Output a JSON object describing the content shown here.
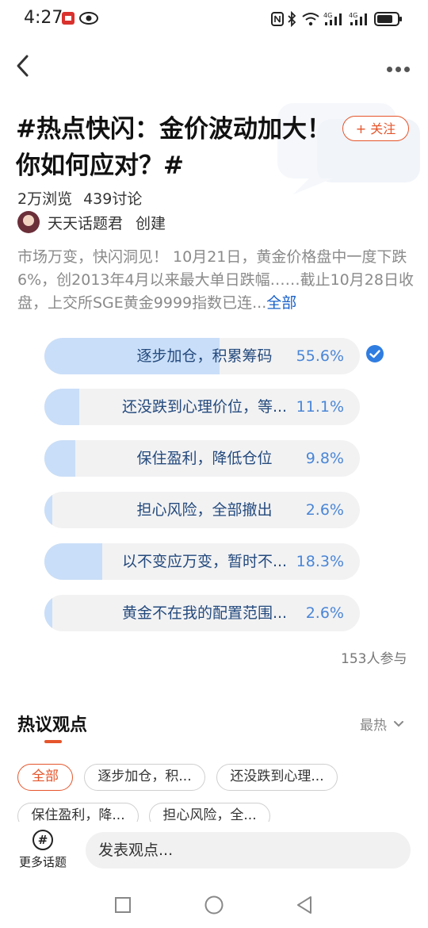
{
  "status_bar": {
    "time": "4:27"
  },
  "topic": {
    "title": "#热点快闪：金价波动加大！你如何应对？#",
    "follow_label": "+ 关注",
    "views": "2万浏览",
    "discussions": "439讨论",
    "creator_name": "天天话题君",
    "creator_action": "创建",
    "description": "市场万变，快闪洞见！ 10月21日，黄金价格盘中一度下跌6%，创2013年4月以来最大单日跌幅……截止10月28日收盘，上交所SGE黄金9999指数已连...",
    "description_more": "全部"
  },
  "poll": {
    "options": [
      {
        "label": "逐步加仓，积累筹码",
        "percent": "55.6%",
        "fraction": 0.556,
        "selected": true
      },
      {
        "label": "还没跌到心理价位，等...",
        "percent": "11.1%",
        "fraction": 0.111,
        "selected": false
      },
      {
        "label": "保住盈利，降低仓位",
        "percent": "9.8%",
        "fraction": 0.098,
        "selected": false
      },
      {
        "label": "担心风险，全部撤出",
        "percent": "2.6%",
        "fraction": 0.026,
        "selected": false
      },
      {
        "label": "以不变应万变，暂时不...",
        "percent": "18.3%",
        "fraction": 0.183,
        "selected": false
      },
      {
        "label": "黄金不在我的配置范围...",
        "percent": "2.6%",
        "fraction": 0.026,
        "selected": false
      }
    ],
    "participants": "153人参与"
  },
  "hot_views": {
    "title": "热议观点",
    "sort_label": "最热",
    "chips": [
      "全部",
      "逐步加仓，积...",
      "还没跌到心理...",
      "保住盈利，降...",
      "担心风险，全..."
    ]
  },
  "bottom_bar": {
    "more_topics_label": "更多话题",
    "comment_placeholder": "发表观点..."
  },
  "colors": {
    "accent": "#e5552b",
    "poll_fill": "#c9def8",
    "link": "#1a61c9"
  }
}
